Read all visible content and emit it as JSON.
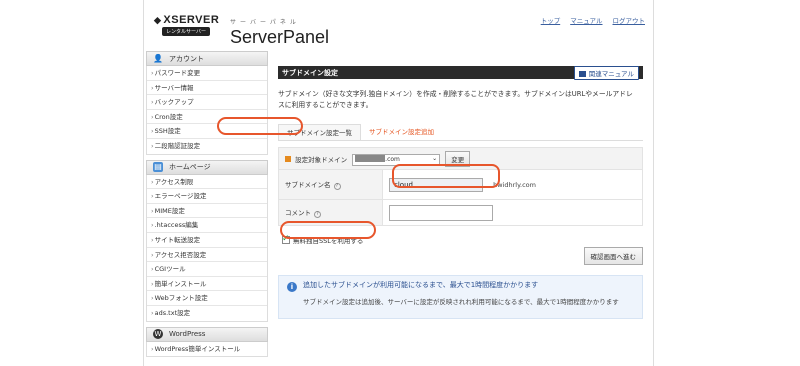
{
  "header": {
    "logo_text": "XSERVER",
    "logo_badge": "レンタルサーバー",
    "subtitle": "サーバーパネル",
    "title": "ServerPanel",
    "links": [
      "トップ",
      "マニュアル",
      "ログアウト"
    ]
  },
  "sidebar": {
    "sections": [
      {
        "title": "アカウント",
        "icon": "user-icon",
        "items": [
          "パスワード変更",
          "サーバー情報",
          "バックアップ",
          "Cron設定",
          "SSH設定",
          "二段階認証設定"
        ]
      },
      {
        "title": "ホームページ",
        "icon": "homepage-icon",
        "items": [
          "アクセス制限",
          "エラーページ設定",
          "MIME設定",
          ".htaccess編集",
          "サイト転送設定",
          "アクセス拒否設定",
          "CGIツール",
          "簡単インストール",
          "Webフォント設定",
          "ads.txt設定"
        ]
      },
      {
        "title": "WordPress",
        "icon": "wordpress-icon",
        "items": [
          "WordPress簡単インストール"
        ]
      }
    ]
  },
  "main": {
    "heading": "サブドメイン設定",
    "manual_button": "関連マニュアル",
    "description": "サブドメイン（好きな文字列.独自ドメイン）を作成・削除することができます。サブドメインはURLやメールアドレスに利用することができます。",
    "tabs": [
      "サブドメイン設定一覧",
      "サブドメイン設定追加"
    ],
    "active_tab": 1,
    "form": {
      "domain_label": "設定対象ドメイン",
      "domain_value": ".com",
      "change_button": "変更",
      "subdomain_label": "サブドメイン名",
      "subdomain_value": "cloud",
      "subdomain_suffix": ".hwidhrly.com",
      "comment_label": "コメント",
      "comment_value": ""
    },
    "ssl_label": "無料独自SSLを利用する",
    "ssl_checked": true,
    "confirm_button": "確認画面へ進む",
    "info": {
      "title": "追加したサブドメインが利用可能になるまで、最大で1時間程度かかります",
      "body": "サブドメイン設定は追加後、サーバーに設定が反映されれ利用可能になるまで、最大で1時間程度かかります"
    }
  },
  "colors": {
    "highlight": "#e7562c",
    "header_bar": "#2b2b2b",
    "link": "#3a5f9f",
    "info_bg": "#eef4fc"
  }
}
